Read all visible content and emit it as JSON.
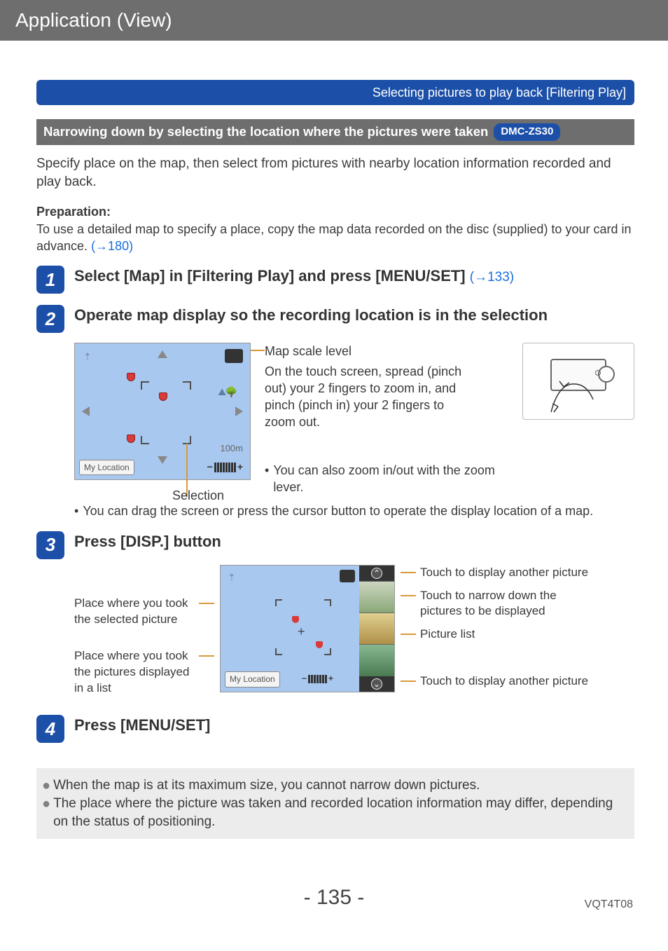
{
  "header": {
    "breadcrumb": "Application (View)"
  },
  "banner": {
    "text": "Selecting pictures to play back  [Filtering Play]"
  },
  "subbar": {
    "label": "Narrowing down by selecting the location where the pictures were taken",
    "model": "DMC-ZS30"
  },
  "intro": "Specify place on the map, then select from pictures with nearby location information recorded and play back.",
  "prep": {
    "title": "Preparation:",
    "text": "To use a detailed map to specify a place, copy the map data recorded on the disc (supplied) to your card in advance. ",
    "link": "(→180)"
  },
  "steps": {
    "s1": {
      "num": "1",
      "title": "Select [Map] in [Filtering Play] and press [MENU/SET] ",
      "link": "(→133)"
    },
    "s2": {
      "num": "2",
      "title": "Operate map display so the recording location is in the selection",
      "map": {
        "my_location": "My Location",
        "scale": "100m",
        "selection_label": "Selection"
      },
      "side": {
        "scale_label": "Map scale level",
        "pinch_text": "On the touch screen, spread (pinch out) your 2 fingers to zoom in, and pinch (pinch in) your 2 fingers to zoom out.",
        "zoom_note": "You can also zoom in/out with the zoom lever."
      },
      "drag_note": "You can drag the screen or press the cursor button to operate the display location of a map."
    },
    "s3": {
      "num": "3",
      "title": "Press [DISP.] button",
      "left_labels": {
        "a": "Place where you took the selected picture",
        "b": "Place where you took the pictures displayed in a list"
      },
      "right_labels": {
        "a": "Touch to display another picture",
        "b": "Touch to narrow down the pictures to be displayed",
        "c": "Picture list",
        "d": "Touch to display another picture"
      },
      "my_location": "My Location"
    },
    "s4": {
      "num": "4",
      "title": "Press [MENU/SET]"
    }
  },
  "notes": {
    "n1": "When the map is at its maximum size, you cannot narrow down pictures.",
    "n2": "The place where the picture was taken and recorded location information may differ, depending on the status of positioning."
  },
  "footer": {
    "page": "- 135 -",
    "doc": "VQT4T08"
  }
}
